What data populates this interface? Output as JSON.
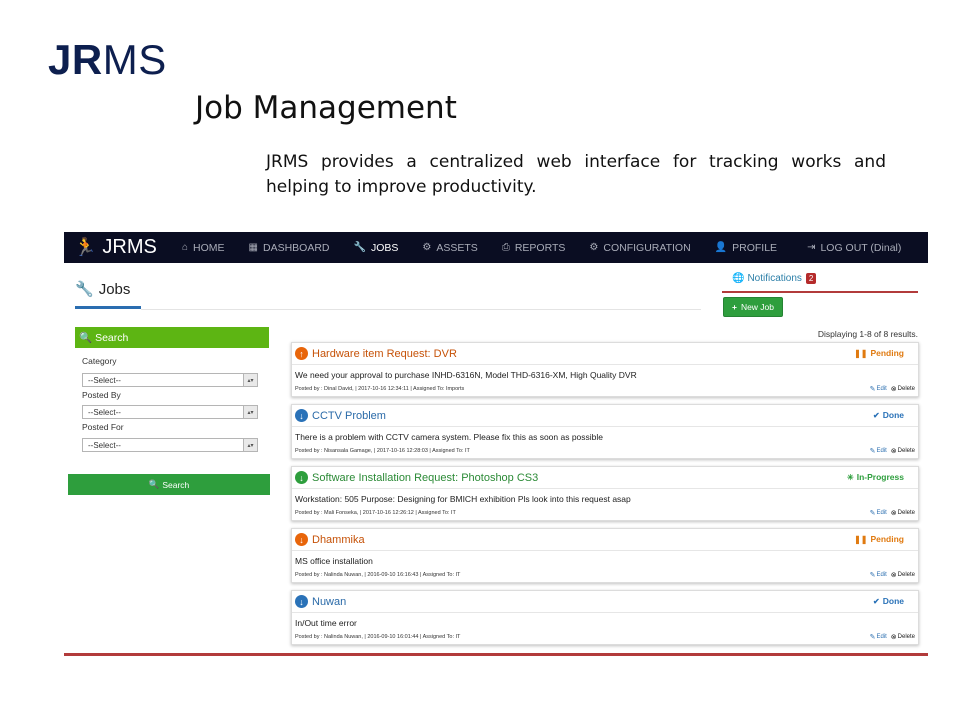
{
  "slide": {
    "logo_bold": "JR",
    "logo_thin": "MS",
    "heading": "Job Management",
    "description": "JRMS provides a centralized web interface for tracking works and helping to improve productivity."
  },
  "navbar": {
    "brand": "JRMS",
    "items": [
      {
        "label": "HOME",
        "icon": "home-icon"
      },
      {
        "label": "DASHBOARD",
        "icon": "dashboard-icon"
      },
      {
        "label": "JOBS",
        "icon": "wrench-icon"
      },
      {
        "label": "ASSETS",
        "icon": "assets-icon"
      },
      {
        "label": "REPORTS",
        "icon": "printer-icon"
      },
      {
        "label": "CONFIGURATION",
        "icon": "gears-icon"
      },
      {
        "label": "PROFILE",
        "icon": "user-icon"
      },
      {
        "label": "LOG OUT (Dinal)",
        "icon": "logout-icon"
      }
    ]
  },
  "page": {
    "title": "Jobs",
    "notifications_label": "Notifications",
    "notifications_count": "2",
    "new_job_label": "New Job",
    "results_text": "Displaying 1-8 of 8 results."
  },
  "filters": {
    "heading": "Search",
    "category_label": "Category",
    "category_value": "--Select--",
    "posted_by_label": "Posted By",
    "posted_by_value": "--Select--",
    "posted_for_label": "Posted For",
    "posted_for_value": "--Select--",
    "search_button": "Search"
  },
  "jobs": [
    {
      "title": "Hardware item Request: DVR",
      "status": "Pending",
      "description": "We need your approval to purchase INHD-6316N, Model THD-6316-XM, High Quality DVR",
      "meta": "Posted by : Dinal David,  | 2017-10-16 12:34:11  | Assigned To: Imports",
      "edit_label": "Edit",
      "delete_label": "Delete"
    },
    {
      "title": "CCTV Problem",
      "status": "Done",
      "description": "There is a problem with CCTV camera system. Please fix this as soon as possible",
      "meta": "Posted by : Nisansala Gamage,  | 2017-10-16 12:28:03  | Assigned To: IT",
      "edit_label": "Edit",
      "delete_label": "Delete"
    },
    {
      "title": "Software Installation Request: Photoshop CS3",
      "status": "In-Progress",
      "description": "Workstation: 505 Purpose: Designing for BMICH exhibition Pls look into this request asap",
      "meta": "Posted by : Mali Fonseka,  | 2017-10-16 12:26:12  | Assigned To: IT",
      "edit_label": "Edit",
      "delete_label": "Delete"
    },
    {
      "title": "Dhammika",
      "status": "Pending",
      "description": "MS office installation",
      "meta": "Posted by : Nalinda Nuwan,  | 2016-09-10 16:16:43  | Assigned To: IT",
      "edit_label": "Edit",
      "delete_label": "Delete"
    },
    {
      "title": "Nuwan",
      "status": "Done",
      "description": "In/Out time error",
      "meta": "Posted by : Nalinda Nuwan,  | 2016-09-10 16:01:44  | Assigned To: IT",
      "edit_label": "Edit",
      "delete_label": "Delete"
    }
  ],
  "colors": {
    "navbar": "#0a0d22",
    "accent_green": "#2e9e3d",
    "search_green": "#5db513",
    "accent_red": "#b23b3b",
    "pending_orange": "#e07a10",
    "done_blue": "#2a72b8"
  }
}
